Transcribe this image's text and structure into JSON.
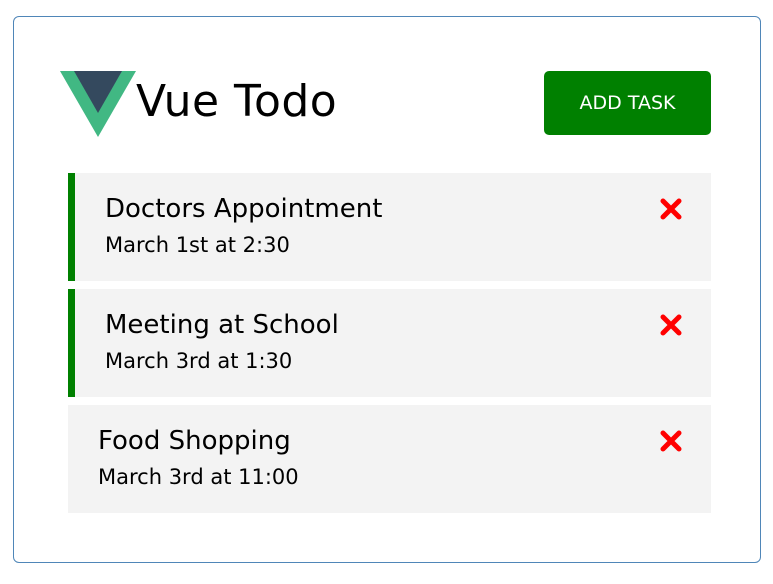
{
  "header": {
    "title": "Vue Todo",
    "add_button_label": "ADD TASK",
    "logo_icon": "vue-logo-icon"
  },
  "colors": {
    "accent": "#008000",
    "delete": "#ff0000",
    "task_bg": "#f3f3f3",
    "border": "#4f86b8",
    "logo_green": "#41b883",
    "logo_dark": "#34495e"
  },
  "tasks": [
    {
      "text": "Doctors Appointment",
      "day": "March 1st at 2:30",
      "reminder": true,
      "delete_icon": "times-icon"
    },
    {
      "text": "Meeting at School",
      "day": "March 3rd at 1:30",
      "reminder": true,
      "delete_icon": "times-icon"
    },
    {
      "text": "Food Shopping",
      "day": "March 3rd at 11:00",
      "reminder": false,
      "delete_icon": "times-icon"
    }
  ]
}
